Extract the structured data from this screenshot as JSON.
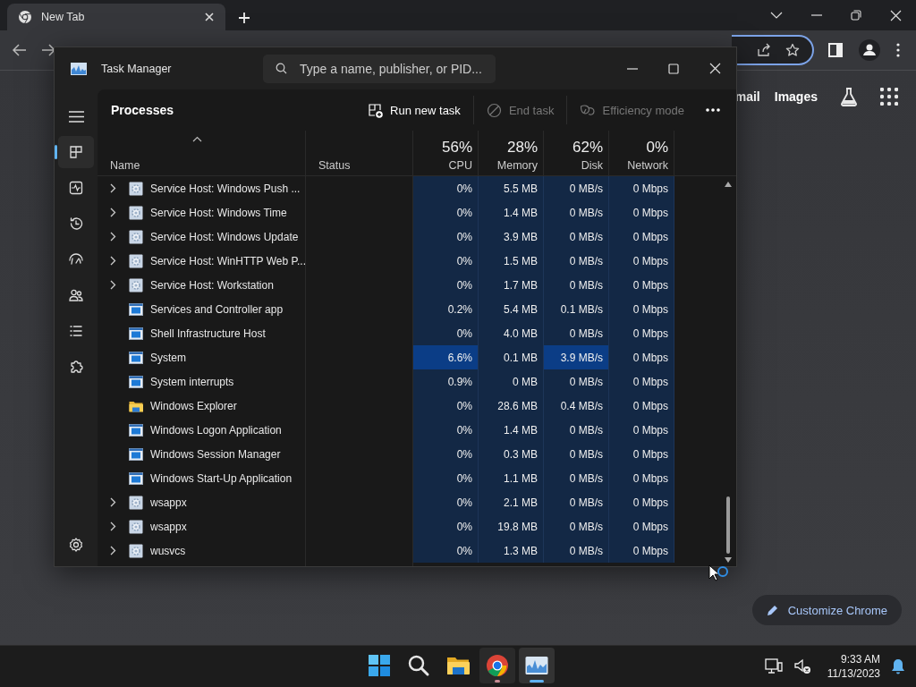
{
  "browser": {
    "tab": {
      "title": "New Tab",
      "selected": true
    },
    "links": [
      "mail",
      "Images"
    ],
    "customize_button": "Customize Chrome"
  },
  "task_manager": {
    "title": "Task Manager",
    "search": {
      "placeholder": "Type a name, publisher, or PID..."
    },
    "nav": [
      {
        "kind": "processes",
        "selected": true
      },
      {
        "kind": "performance",
        "selected": false
      },
      {
        "kind": "history",
        "selected": false
      },
      {
        "kind": "startup",
        "selected": false
      },
      {
        "kind": "users",
        "selected": false
      },
      {
        "kind": "details",
        "selected": false
      },
      {
        "kind": "services",
        "selected": false
      },
      {
        "kind": "settings",
        "selected": false
      }
    ],
    "page_title": "Processes",
    "actions": [
      {
        "kind": "run",
        "label": "Run new task",
        "disabled": false
      },
      {
        "kind": "end",
        "label": "End task",
        "disabled": true
      },
      {
        "kind": "efficiency",
        "label": "Efficiency mode",
        "disabled": true
      }
    ],
    "columns": [
      {
        "label": "Name",
        "sorted": true
      },
      {
        "label": "Status",
        "sorted": false
      }
    ],
    "usage_columns": [
      {
        "label": "CPU",
        "total": "56%"
      },
      {
        "label": "Memory",
        "total": "28%"
      },
      {
        "label": "Disk",
        "total": "62%"
      },
      {
        "label": "Network",
        "total": "0%"
      }
    ],
    "rows": [
      {
        "name": "Service Host: Windows Push ...",
        "kind": "service",
        "expandable": true,
        "cells": [
          {
            "value": "0%",
            "hot": false
          },
          {
            "value": "5.5 MB",
            "hot": false
          },
          {
            "value": "0 MB/s",
            "hot": false
          },
          {
            "value": "0 Mbps",
            "hot": false
          }
        ]
      },
      {
        "name": "Service Host: Windows Time",
        "kind": "service",
        "expandable": true,
        "cells": [
          {
            "value": "0%",
            "hot": false
          },
          {
            "value": "1.4 MB",
            "hot": false
          },
          {
            "value": "0 MB/s",
            "hot": false
          },
          {
            "value": "0 Mbps",
            "hot": false
          }
        ]
      },
      {
        "name": "Service Host: Windows Update",
        "kind": "service",
        "expandable": true,
        "cells": [
          {
            "value": "0%",
            "hot": false
          },
          {
            "value": "3.9 MB",
            "hot": false
          },
          {
            "value": "0 MB/s",
            "hot": false
          },
          {
            "value": "0 Mbps",
            "hot": false
          }
        ]
      },
      {
        "name": "Service Host: WinHTTP Web P...",
        "kind": "service",
        "expandable": true,
        "cells": [
          {
            "value": "0%",
            "hot": false
          },
          {
            "value": "1.5 MB",
            "hot": false
          },
          {
            "value": "0 MB/s",
            "hot": false
          },
          {
            "value": "0 Mbps",
            "hot": false
          }
        ]
      },
      {
        "name": "Service Host: Workstation",
        "kind": "service",
        "expandable": true,
        "cells": [
          {
            "value": "0%",
            "hot": false
          },
          {
            "value": "1.7 MB",
            "hot": false
          },
          {
            "value": "0 MB/s",
            "hot": false
          },
          {
            "value": "0 Mbps",
            "hot": false
          }
        ]
      },
      {
        "name": "Services and Controller app",
        "kind": "app",
        "expandable": false,
        "cells": [
          {
            "value": "0.2%",
            "hot": false
          },
          {
            "value": "5.4 MB",
            "hot": false
          },
          {
            "value": "0.1 MB/s",
            "hot": false
          },
          {
            "value": "0 Mbps",
            "hot": false
          }
        ]
      },
      {
        "name": "Shell Infrastructure Host",
        "kind": "app",
        "expandable": false,
        "cells": [
          {
            "value": "0%",
            "hot": false
          },
          {
            "value": "4.0 MB",
            "hot": false
          },
          {
            "value": "0 MB/s",
            "hot": false
          },
          {
            "value": "0 Mbps",
            "hot": false
          }
        ]
      },
      {
        "name": "System",
        "kind": "app",
        "expandable": false,
        "cells": [
          {
            "value": "6.6%",
            "hot": true
          },
          {
            "value": "0.1 MB",
            "hot": false
          },
          {
            "value": "3.9 MB/s",
            "hot": true
          },
          {
            "value": "0 Mbps",
            "hot": false
          }
        ]
      },
      {
        "name": "System interrupts",
        "kind": "app",
        "expandable": false,
        "cells": [
          {
            "value": "0.9%",
            "hot": false
          },
          {
            "value": "0 MB",
            "hot": false
          },
          {
            "value": "0 MB/s",
            "hot": false
          },
          {
            "value": "0 Mbps",
            "hot": false
          }
        ]
      },
      {
        "name": "Windows Explorer",
        "kind": "folder",
        "expandable": false,
        "cells": [
          {
            "value": "0%",
            "hot": false
          },
          {
            "value": "28.6 MB",
            "hot": false
          },
          {
            "value": "0.4 MB/s",
            "hot": false
          },
          {
            "value": "0 Mbps",
            "hot": false
          }
        ]
      },
      {
        "name": "Windows Logon Application",
        "kind": "app",
        "expandable": false,
        "cells": [
          {
            "value": "0%",
            "hot": false
          },
          {
            "value": "1.4 MB",
            "hot": false
          },
          {
            "value": "0 MB/s",
            "hot": false
          },
          {
            "value": "0 Mbps",
            "hot": false
          }
        ]
      },
      {
        "name": "Windows Session Manager",
        "kind": "app",
        "expandable": false,
        "cells": [
          {
            "value": "0%",
            "hot": false
          },
          {
            "value": "0.3 MB",
            "hot": false
          },
          {
            "value": "0 MB/s",
            "hot": false
          },
          {
            "value": "0 Mbps",
            "hot": false
          }
        ]
      },
      {
        "name": "Windows Start-Up Application",
        "kind": "app",
        "expandable": false,
        "cells": [
          {
            "value": "0%",
            "hot": false
          },
          {
            "value": "1.1 MB",
            "hot": false
          },
          {
            "value": "0 MB/s",
            "hot": false
          },
          {
            "value": "0 Mbps",
            "hot": false
          }
        ]
      },
      {
        "name": "wsappx",
        "kind": "service",
        "expandable": true,
        "cells": [
          {
            "value": "0%",
            "hot": false
          },
          {
            "value": "2.1 MB",
            "hot": false
          },
          {
            "value": "0 MB/s",
            "hot": false
          },
          {
            "value": "0 Mbps",
            "hot": false
          }
        ]
      },
      {
        "name": "wsappx",
        "kind": "service",
        "expandable": true,
        "cells": [
          {
            "value": "0%",
            "hot": false
          },
          {
            "value": "19.8 MB",
            "hot": false
          },
          {
            "value": "0 MB/s",
            "hot": false
          },
          {
            "value": "0 Mbps",
            "hot": false
          }
        ]
      },
      {
        "name": "wusvcs",
        "kind": "service",
        "expandable": true,
        "cells": [
          {
            "value": "0%",
            "hot": false
          },
          {
            "value": "1.3 MB",
            "hot": false
          },
          {
            "value": "0 MB/s",
            "hot": false
          },
          {
            "value": "0 Mbps",
            "hot": false
          }
        ]
      }
    ]
  },
  "taskbar": {
    "apps": [
      {
        "kind": "start",
        "running": false,
        "active": false
      },
      {
        "kind": "search",
        "running": false,
        "active": false
      },
      {
        "kind": "explorer",
        "running": false,
        "active": false
      },
      {
        "kind": "chrome",
        "running": true,
        "active": false
      },
      {
        "kind": "taskmanager",
        "running": true,
        "active": true
      }
    ],
    "time": "9:33 AM",
    "date": "11/13/2023"
  }
}
